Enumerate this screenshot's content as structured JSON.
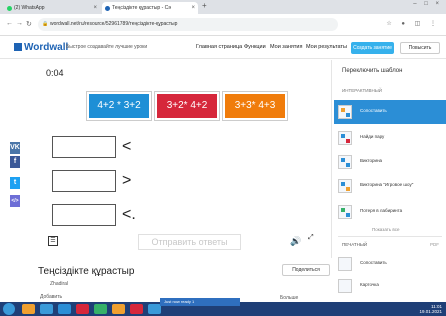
{
  "browser": {
    "tabs": [
      {
        "label": "(2) WhatsApp",
        "favicon_color": "#25d366"
      },
      {
        "label": "Теңсіздікте құрастыр - Сә",
        "favicon_color": "#1e63b4"
      }
    ],
    "new_tab": "+",
    "url": "wordwall.net/ru/resource/52961789/теңсіздікте-құрастыр",
    "window_controls": "– □ ×"
  },
  "header": {
    "logo": "Wordwall",
    "tagline": "Быстрое создавайте лучшие уроки",
    "nav": [
      "Главная страница",
      "Функции",
      "Мои занятия",
      "Мои результаты"
    ],
    "create_button": "Создать занятие",
    "upgrade_button": "Повысить",
    "user": "zhadiral"
  },
  "game": {
    "timer": "0:04",
    "cards": [
      {
        "text": "4+2 * 3+2",
        "color": "#1e8fd6"
      },
      {
        "text": "3+2* 4+2",
        "color": "#d6273b"
      },
      {
        "text": "3+3* 4+3",
        "color": "#f07c0b"
      }
    ],
    "operators": [
      "<",
      ">",
      "<."
    ],
    "submit_label": "Отправить ответы",
    "menu_icon": "☰",
    "sound_icon": "🔊",
    "fullscreen_icon": "⤢"
  },
  "social": [
    {
      "label": "vk",
      "glyph": "VK",
      "color": "#4a76a8"
    },
    {
      "label": "facebook",
      "glyph": "f",
      "color": "#3b5998"
    },
    {
      "label": "twitter",
      "glyph": "t",
      "color": "#1da1f2"
    },
    {
      "label": "share",
      "glyph": "</>",
      "color": "#6d6ed6"
    }
  ],
  "sidebar": {
    "title": "Переключить шаблон",
    "section": "ИНТЕРАКТИВНЫЙ",
    "templates": [
      {
        "label": "Сопоставить",
        "active": true,
        "icon_colors": [
          "#f0a030",
          "#2b8ed6"
        ]
      },
      {
        "label": "Найди пару",
        "active": false,
        "icon_colors": [
          "#2b8ed6",
          "#d6273b"
        ]
      },
      {
        "label": "Викторина",
        "active": false,
        "icon_colors": [
          "#2b8ed6",
          "#2b8ed6"
        ]
      },
      {
        "label": "Викторина \"Игровое шоу\"",
        "active": false,
        "icon_colors": [
          "#2b8ed6",
          "#f0a030"
        ]
      },
      {
        "label": "Потеря в лабиринта",
        "active": false,
        "icon_colors": [
          "#36b169",
          "#2b8ed6"
        ]
      }
    ],
    "show_all": "Показать все",
    "printed_label": "ПЕЧАТНЫЙ",
    "pdf_label": "PDF",
    "printed_items": [
      "Сопоставить",
      "Карточка"
    ]
  },
  "activity": {
    "title": "Теңсіздікте құрастыр",
    "author": "Zhadiral",
    "add_link": "Добавить",
    "share_button": "Поделиться",
    "more": "Больше"
  },
  "taskbar": {
    "popup": "Just now ready 1",
    "clock_time": "11:01",
    "clock_date": "19.01.2021",
    "apps": [
      "#f0a030",
      "#3a9ad9",
      "#2b8ed6",
      "#d6273b",
      "#36b169",
      "#f0a030",
      "#d6273b",
      "#3a9ad9"
    ]
  }
}
